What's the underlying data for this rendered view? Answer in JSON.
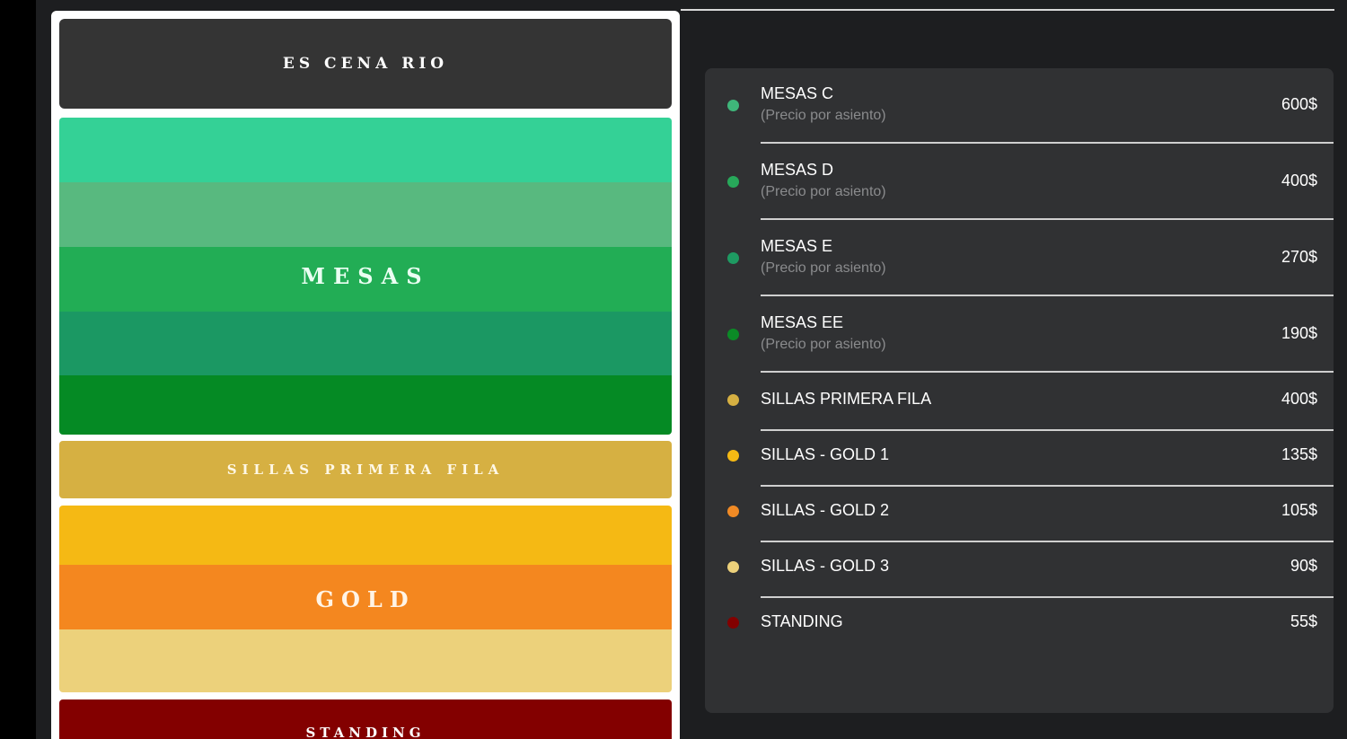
{
  "map": {
    "stage_label": "ES CENA RIO",
    "zones": {
      "mesas": {
        "label": "MESAS",
        "bands": [
          "#34d196",
          "#58b97f",
          "#22ad55",
          "#1b9863",
          "#058a24"
        ]
      },
      "sillas_primera_fila": {
        "label": "SILLAS PRIMERA FILA",
        "bands": [
          "#d6b042"
        ]
      },
      "gold": {
        "label": "GOLD",
        "bands": [
          "#f5b914",
          "#f4871f",
          "#ecd17b"
        ]
      },
      "standing": {
        "label": "STANDING",
        "bands": [
          "#830000"
        ]
      }
    }
  },
  "prices": {
    "items": [
      {
        "name": "MESAS C",
        "sub": "(Precio por asiento)",
        "price": "600$",
        "color": "#3fb67a"
      },
      {
        "name": "MESAS D",
        "sub": "(Precio por asiento)",
        "price": "400$",
        "color": "#27a85a"
      },
      {
        "name": "MESAS E",
        "sub": "(Precio por asiento)",
        "price": "270$",
        "color": "#1e9a62"
      },
      {
        "name": "MESAS EE",
        "sub": "(Precio por asiento)",
        "price": "190$",
        "color": "#0b8a26"
      },
      {
        "name": "SILLAS PRIMERA FILA",
        "price": "400$",
        "color": "#d6b042"
      },
      {
        "name": "SILLAS - GOLD 1",
        "price": "135$",
        "color": "#f5b914"
      },
      {
        "name": "SILLAS - GOLD 2",
        "price": "105$",
        "color": "#f08a25"
      },
      {
        "name": "SILLAS - GOLD 3",
        "price": "90$",
        "color": "#ecd17b"
      },
      {
        "name": "STANDING",
        "price": "55$",
        "color": "#830000"
      }
    ]
  }
}
